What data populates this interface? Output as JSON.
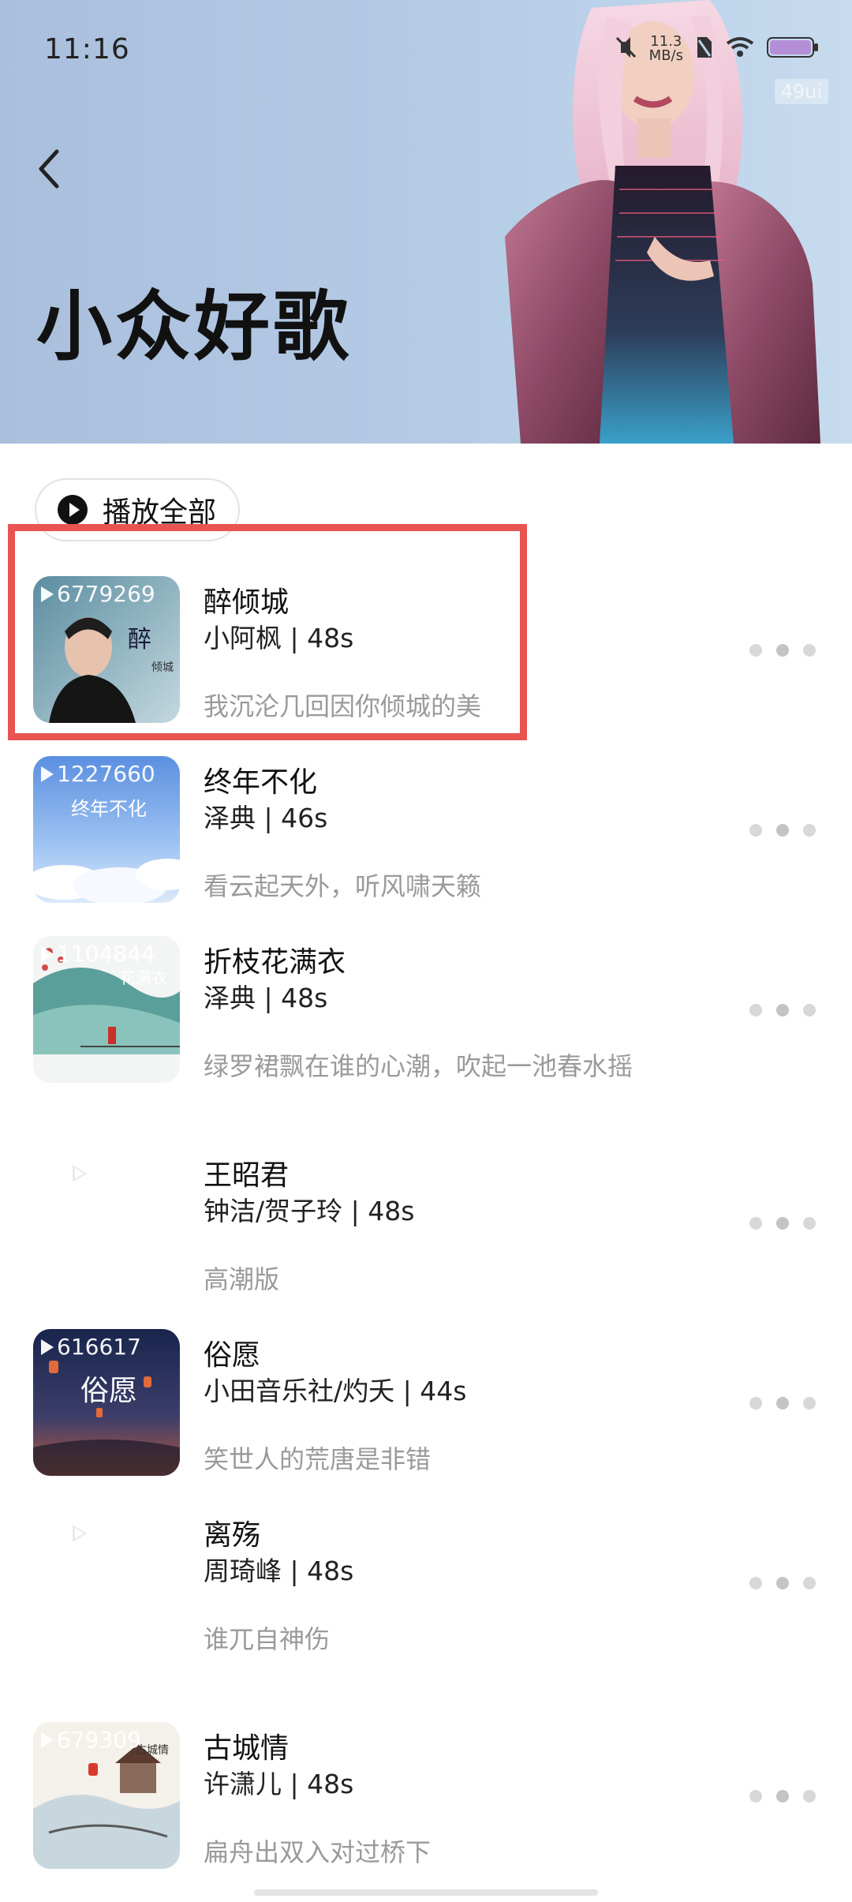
{
  "status_bar": {
    "time": "11:16",
    "net_speed": "11.3",
    "net_unit": "MB/s",
    "badge": "49ui"
  },
  "header": {
    "title": "小众好歌"
  },
  "play_all": {
    "label": "播放全部"
  },
  "songs": [
    {
      "title": "醉倾城",
      "meta": "小阿枫 | 48s",
      "lyric": "我沉沦几回因你倾城的美",
      "play_count": "6779269",
      "cover_style": "photo-man",
      "cover_text": "醉 倾城"
    },
    {
      "title": "终年不化",
      "meta": "泽典 | 46s",
      "lyric": "看云起天外，听风啸天籁",
      "play_count": "1227660",
      "cover_style": "sky",
      "cover_text": "终年不化"
    },
    {
      "title": "折枝花满衣",
      "meta": "泽典 | 48s",
      "lyric": "绿罗裙飘在谁的心潮，吹起一池春水摇",
      "play_count": "1104844",
      "cover_style": "ink",
      "cover_text": "花满衣"
    },
    {
      "title": "王昭君",
      "meta": "钟洁/贺子玲 | 48s",
      "lyric": "高潮版",
      "play_count": "",
      "cover_style": "blank",
      "cover_text": ""
    },
    {
      "title": "俗愿",
      "meta": "小田音乐社/灼夭 | 44s",
      "lyric": "笑世人的荒唐是非错",
      "play_count": "616617",
      "cover_style": "night",
      "cover_text": "俗愿"
    },
    {
      "title": "离殇",
      "meta": "周琦峰 | 48s",
      "lyric": "谁兀自神伤",
      "play_count": "",
      "cover_style": "blank",
      "cover_text": ""
    },
    {
      "title": "古城情",
      "meta": "许潇儿 | 48s",
      "lyric": "扁舟出双入对过桥下",
      "play_count": "679309",
      "cover_style": "oldtown",
      "cover_text": "古城情"
    }
  ],
  "colors": {
    "accent_highlight": "#e85450",
    "header_bg": "#b3c9e4",
    "lyric_gray": "#9a9a9a"
  },
  "icons": {
    "back": "chevron-left-icon",
    "play": "play-circle-icon",
    "more": "more-dots-icon"
  }
}
